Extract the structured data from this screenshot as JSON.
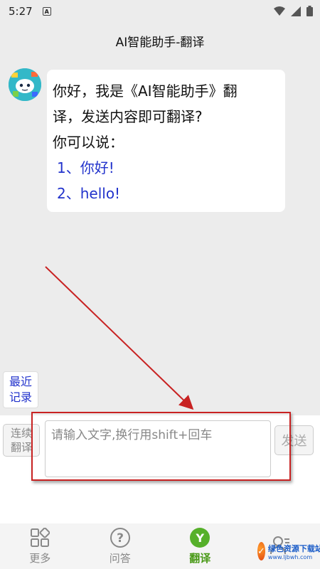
{
  "status_bar": {
    "time": "5:27",
    "notification_icon": "A",
    "icons": [
      "wifi-icon",
      "signal-icon",
      "battery-icon"
    ]
  },
  "header": {
    "title": "AI智能助手-翻译"
  },
  "chat": {
    "bot_message": {
      "lines": [
        "你好，我是《AI智能助手》翻",
        "译，发送内容即可翻译?",
        "你可以说："
      ],
      "examples": [
        "1、你好!",
        "2、hello!"
      ]
    },
    "recent_button": {
      "line1": "最近",
      "line2": "记录"
    }
  },
  "input_area": {
    "continuous_button": {
      "line1": "连续",
      "line2": "翻译"
    },
    "input": {
      "value": "",
      "placeholder": "请输入文字,换行用shift+回车"
    },
    "send_label": "发送"
  },
  "bottom_nav": {
    "items": [
      {
        "label": "更多",
        "icon": "grid-icon"
      },
      {
        "label": "问答",
        "icon": "question-icon"
      },
      {
        "label": "翻译",
        "icon": "Y",
        "active": true
      },
      {
        "label": "",
        "icon": "user-list-icon"
      }
    ]
  },
  "watermark": {
    "title": "绿色资源下载站",
    "url": "www.ljbwh.com"
  },
  "colors": {
    "background": "#ececec",
    "example_text": "#2233cc",
    "active_nav": "#4a9a18",
    "annotation": "#c82222"
  }
}
